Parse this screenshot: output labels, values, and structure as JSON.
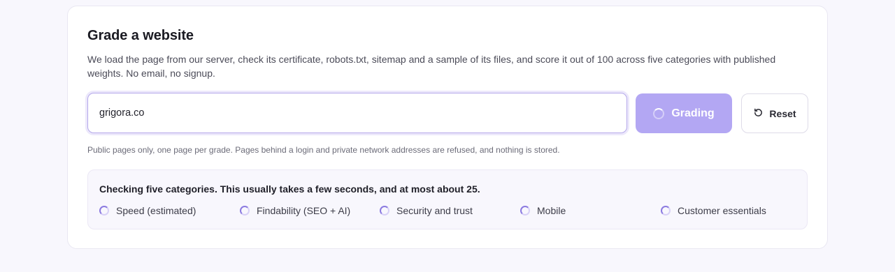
{
  "grader": {
    "title": "Grade a website",
    "description": "We load the page from our server, check its certificate, robots.txt, sitemap and a sample of its files, and score it out of 100 across five categories with published weights. No email, no signup.",
    "url_value": "grigora.co",
    "grade_button_label": "Grading",
    "reset_button_label": "Reset",
    "hint": "Public pages only, one page per grade. Pages behind a login and private network addresses are refused, and nothing is stored."
  },
  "status": {
    "message": "Checking five categories. This usually takes a few seconds, and at most about 25.",
    "categories": [
      {
        "label": "Speed (estimated)",
        "icon": "spinner-icon"
      },
      {
        "label": "Findability (SEO + AI)",
        "icon": "spinner-icon"
      },
      {
        "label": "Security and trust",
        "icon": "spinner-icon"
      },
      {
        "label": "Mobile",
        "icon": "spinner-icon"
      },
      {
        "label": "Customer essentials",
        "icon": "spinner-icon"
      }
    ]
  },
  "colors": {
    "accent": "#b3a7f3",
    "spinner": "#8b7ae0",
    "background": "#f8f7fd"
  }
}
